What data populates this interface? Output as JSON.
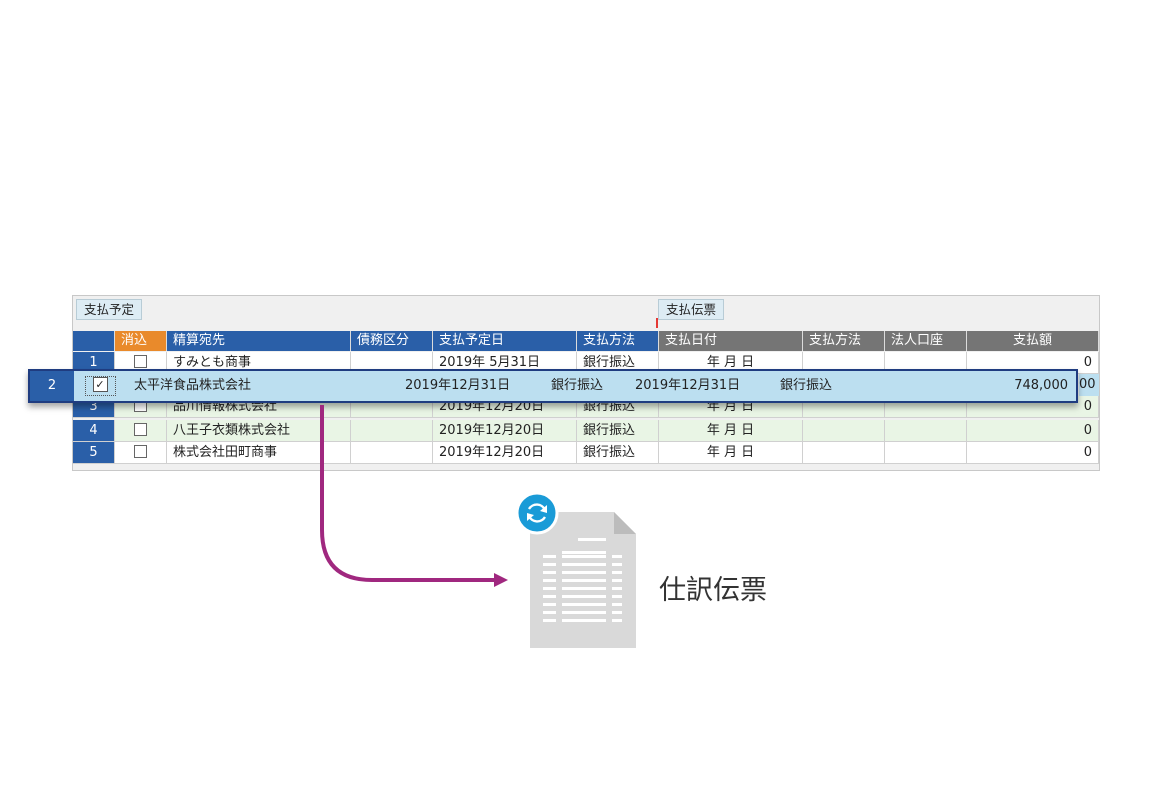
{
  "sections": {
    "left": "支払予定",
    "right": "支払伝票"
  },
  "columns": {
    "clear": "消込",
    "payee": "精算宛先",
    "debt_type": "債務区分",
    "scheduled_date": "支払予定日",
    "method": "支払方法",
    "pay_date": "支払日付",
    "method2": "支払方法",
    "corp_account": "法人口座",
    "amount": "支払額"
  },
  "rows": [
    {
      "num": "1",
      "payee": "すみとも商事",
      "scheduled_date": "2019年  5月31日",
      "method": "銀行振込",
      "pay_date": "年   月   日",
      "amount": "0"
    },
    {
      "num": "3",
      "payee": "品川情報株式会社",
      "scheduled_date": "2019年12月20日",
      "method": "銀行振込",
      "pay_date": "年   月   日",
      "amount": "0"
    },
    {
      "num": "4",
      "payee": "八王子衣類株式会社",
      "scheduled_date": "2019年12月20日",
      "method": "銀行振込",
      "pay_date": "年   月   日",
      "amount": "0"
    },
    {
      "num": "5",
      "payee": "株式会社田町商事",
      "scheduled_date": "2019年12月20日",
      "method": "銀行振込",
      "pay_date": "年   月   日",
      "amount": "0"
    }
  ],
  "highlight": {
    "num": "2",
    "checked": true,
    "check_glyph": "✓",
    "payee": "太平洋食品株式会社",
    "scheduled_date": "2019年12月31日",
    "method": "銀行振込",
    "pay_date": "2019年12月31日",
    "method2": "銀行振込",
    "amount": "748,000",
    "peek_amount": "00"
  },
  "document": {
    "title": "仕訳伝票",
    "icon": "refresh-icon"
  },
  "colors": {
    "header_blue": "#2a5fa8",
    "header_orange": "#e98a2b",
    "header_gray": "#757575",
    "arrow": "#a0287f",
    "refresh": "#1a9bd7"
  }
}
